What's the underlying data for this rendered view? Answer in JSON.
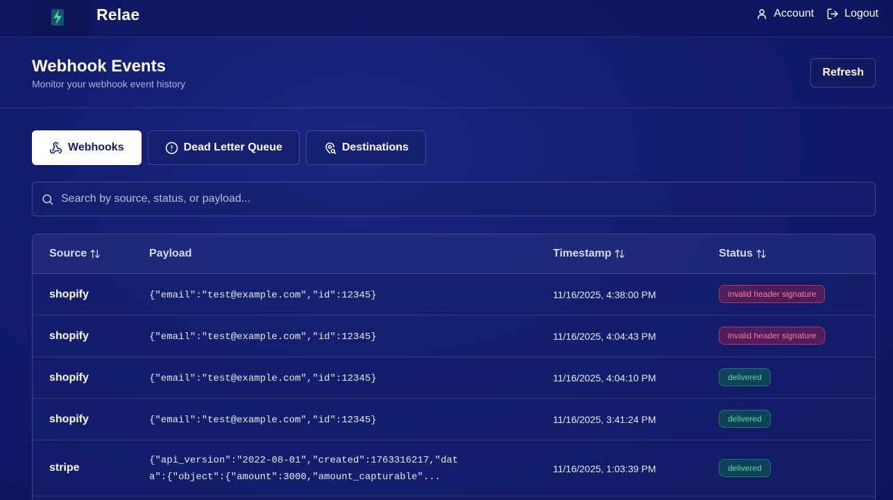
{
  "app": {
    "brand": "Relae"
  },
  "nav": {
    "account_label": "Account",
    "logout_label": "Logout"
  },
  "header": {
    "title": "Webhook Events",
    "subtitle": "Monitor your webhook event history",
    "refresh_label": "Refresh"
  },
  "tabs": [
    {
      "label": "Webhooks",
      "icon": "webhook-icon",
      "active": true
    },
    {
      "label": "Dead Letter Queue",
      "icon": "alert-circle-icon",
      "active": false
    },
    {
      "label": "Destinations",
      "icon": "map-pin-search-icon",
      "active": false
    }
  ],
  "search": {
    "placeholder": "Search by source, status, or payload...",
    "value": ""
  },
  "table": {
    "columns": [
      "Source",
      "Payload",
      "Timestamp",
      "Status"
    ],
    "rows": [
      {
        "source": "shopify",
        "payload": "{\"email\":\"test@example.com\",\"id\":12345}",
        "timestamp": "11/16/2025, 4:38:00 PM",
        "status": "invalid header signature",
        "status_type": "error"
      },
      {
        "source": "shopify",
        "payload": "{\"email\":\"test@example.com\",\"id\":12345}",
        "timestamp": "11/16/2025, 4:04:43 PM",
        "status": "invalid header signature",
        "status_type": "error"
      },
      {
        "source": "shopify",
        "payload": "{\"email\":\"test@example.com\",\"id\":12345}",
        "timestamp": "11/16/2025, 4:04:10 PM",
        "status": "delivered",
        "status_type": "success"
      },
      {
        "source": "shopify",
        "payload": "{\"email\":\"test@example.com\",\"id\":12345}",
        "timestamp": "11/16/2025, 3:41:24 PM",
        "status": "delivered",
        "status_type": "success"
      },
      {
        "source": "stripe",
        "payload": "{\"api_version\":\"2022-08-01\",\"created\":1763316217,\"data\":{\"object\":{\"amount\":3000,\"amount_capturable\"...",
        "timestamp": "11/16/2025, 1:03:39 PM",
        "status": "delivered",
        "status_type": "success"
      }
    ]
  },
  "colors": {
    "background": "#121c6e",
    "error_text": "#ff7a93",
    "success_text": "#3fe09c",
    "logo_accent": "#2ec9a0"
  }
}
